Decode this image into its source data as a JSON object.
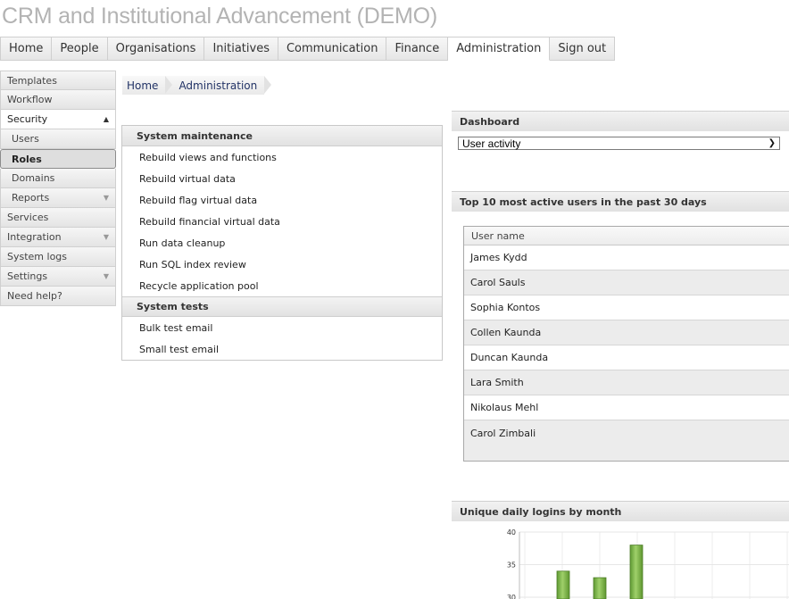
{
  "app": {
    "title": "CRM and Institutional Advancement (DEMO)"
  },
  "top_nav": [
    "Home",
    "People",
    "Organisations",
    "Initiatives",
    "Communication",
    "Finance",
    "Administration",
    "Sign out"
  ],
  "top_nav_active": "Administration",
  "side_nav": {
    "templates": "Templates",
    "workflow": "Workflow",
    "security": "Security",
    "users": "Users",
    "roles": "Roles",
    "domains": "Domains",
    "reports": "Reports",
    "services": "Services",
    "integration": "Integration",
    "system_logs": "System logs",
    "settings": "Settings",
    "need_help": "Need help?"
  },
  "breadcrumb": [
    "Home",
    "Administration"
  ],
  "maintenance": {
    "system_maintenance_title": "System maintenance",
    "maintenance_items": [
      "Rebuild views and functions",
      "Rebuild virtual data",
      "Rebuild flag virtual data",
      "Rebuild financial virtual data",
      "Run data cleanup",
      "Run SQL index review",
      "Recycle application pool"
    ],
    "system_tests_title": "System tests",
    "test_items": [
      "Bulk test email",
      "Small test email"
    ]
  },
  "dashboard": {
    "title": "Dashboard",
    "selected_view": "User activity"
  },
  "active_users": {
    "title": "Top 10 most active users in the past 30 days",
    "column_header": "User name",
    "rows": [
      "James Kydd",
      "Carol Sauls",
      "Sophia Kontos",
      "Collen Kaunda",
      "Duncan Kaunda",
      "Lara Smith",
      "Nikolaus Mehl",
      "Carol Zimbali"
    ]
  },
  "logins_chart": {
    "title": "Unique daily logins by month"
  },
  "chart_data": {
    "type": "bar",
    "title": "Unique daily logins by month",
    "y_ticks": [
      30,
      35,
      40
    ],
    "ylim_visible": [
      29,
      40
    ],
    "values": [
      34,
      33,
      38
    ],
    "bar_color": "#7fb24a",
    "grid": true
  },
  "colors": {
    "title_grey": "#b3b3b3",
    "link_blue": "#223366",
    "bar_green": "#7fb24a"
  }
}
